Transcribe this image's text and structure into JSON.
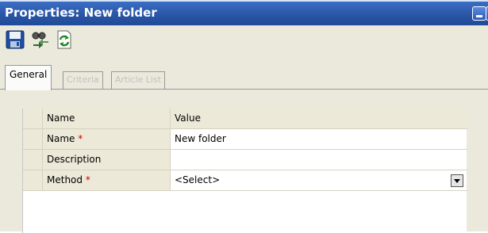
{
  "window": {
    "title": "Properties: New folder"
  },
  "toolbar": {
    "buttons": [
      {
        "icon": "save-icon"
      },
      {
        "icon": "find-replace-icon"
      },
      {
        "icon": "refresh-icon"
      }
    ]
  },
  "tabs": [
    {
      "label": "General",
      "state": "active"
    },
    {
      "label": "Criteria",
      "state": "disabled"
    },
    {
      "label": "Article List",
      "state": "disabled"
    }
  ],
  "grid": {
    "headers": {
      "name": "Name",
      "value": "Value"
    },
    "rows": [
      {
        "name": "Name",
        "required_mark": "*",
        "value": "New folder"
      },
      {
        "name": "Description",
        "required_mark": "",
        "value": ""
      },
      {
        "name": "Method",
        "required_mark": "*",
        "value": "<Select>"
      }
    ]
  },
  "colors": {
    "titlebar": "#2a56a6",
    "required": "#cc0000",
    "panel": "#ebe9dc"
  }
}
